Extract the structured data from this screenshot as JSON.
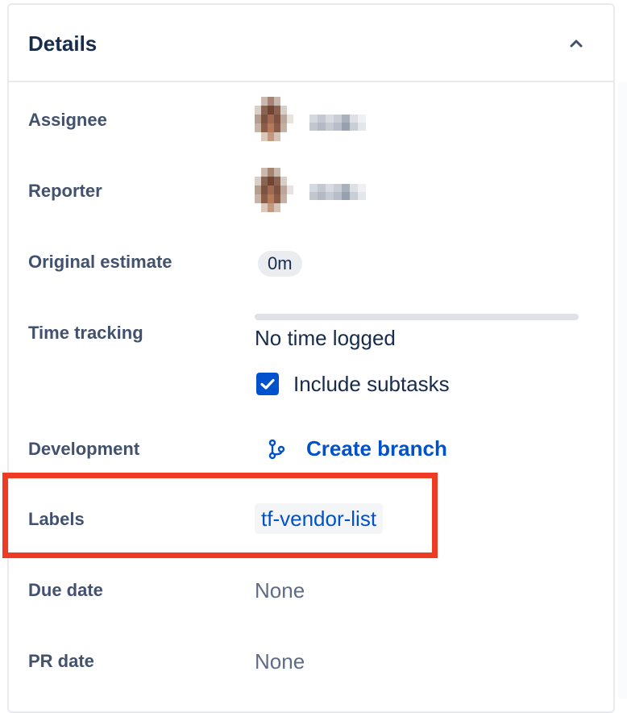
{
  "panel": {
    "title": "Details",
    "collapse_icon": "chevron-up-icon"
  },
  "fields": {
    "assignee": {
      "label": "Assignee"
    },
    "reporter": {
      "label": "Reporter"
    },
    "original_estimate": {
      "label": "Original estimate",
      "value": "0m"
    },
    "time_tracking": {
      "label": "Time tracking",
      "status": "No time logged",
      "progress": 0,
      "include_subtasks_label": "Include subtasks",
      "include_subtasks_checked": true
    },
    "development": {
      "label": "Development",
      "action": "Create branch",
      "icon": "git-branch-icon"
    },
    "labels": {
      "label": "Labels",
      "value": "tf-vendor-list"
    },
    "due_date": {
      "label": "Due date",
      "value": "None"
    },
    "pr_date": {
      "label": "PR date",
      "value": "None"
    }
  },
  "colors": {
    "accent": "#0052cc",
    "highlight": "#ee3b24",
    "label_text": "#42526e",
    "heading": "#172b4d"
  }
}
